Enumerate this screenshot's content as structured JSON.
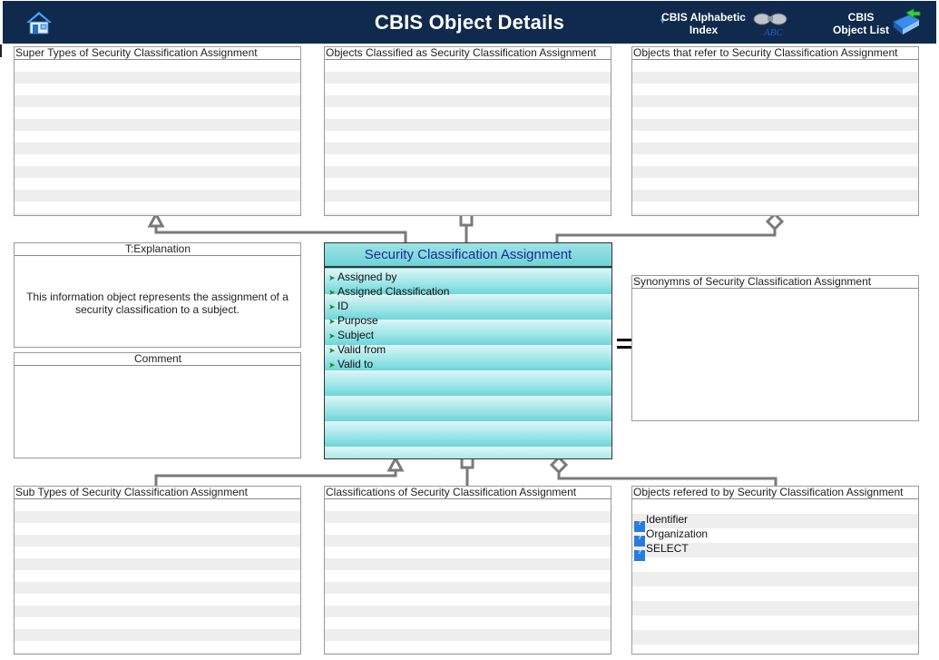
{
  "header": {
    "title": "CBIS Object Details",
    "alpha_index_label": "CBIS Alphabetic Index",
    "object_list_label": "CBIS Object List",
    "home_icon": "home-icon",
    "binoculars_icon": "binoculars-icon",
    "binoculars_text": "ABC",
    "book_icon": "book-arrow-icon",
    "alpha_marker": "▼"
  },
  "panels": {
    "super_types": "Super Types of Security Classification Assignment",
    "objects_classified_as": "Objects Classified as  Security Classification Assignment",
    "objects_refer_to": "Objects that refer to   Security Classification Assignment",
    "explanation_title": "T:Explanation",
    "explanation_text": "This information object represents the assignment of a security classification to a subject.",
    "comment_title": "Comment",
    "synonyms": "Synonymns   of Security Classification Assignment",
    "sub_types": "Sub Types of Security Classification Assignment",
    "classifications_of": "Classifications of  Security Classification Assignment",
    "objects_refered_to_by": "Objects refered to by   Security Classification Assignment"
  },
  "center": {
    "title": "Security Classification Assignment",
    "attributes": [
      "Assigned by",
      "Assigned Classification",
      "ID",
      "Purpose",
      "Subject",
      "Valid from",
      "Valid to"
    ]
  },
  "referred_by_items": [
    "Identifier",
    "Organization",
    "SELECT"
  ],
  "colors": {
    "header_bg": "#0f2a4d",
    "connector": "#7a7a7a",
    "center_title": "#1a2a9a",
    "attribute_arrow": "#1c8a1c",
    "ref_icon": "#2a7be0"
  }
}
